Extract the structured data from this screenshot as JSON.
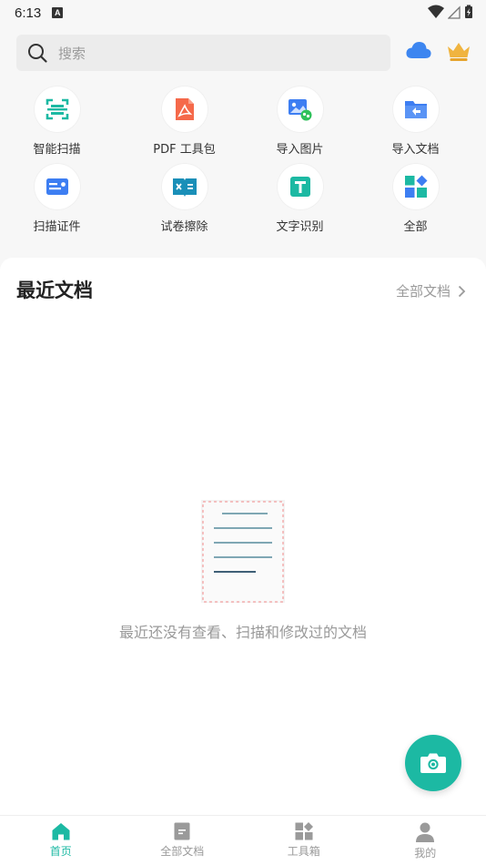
{
  "status": {
    "time": "6:13",
    "indicator": "A"
  },
  "search": {
    "placeholder": "搜索"
  },
  "header_icons": [
    "cloud-icon",
    "crown-icon"
  ],
  "tools": [
    {
      "label": "智能扫描",
      "icon": "scan-frame-icon",
      "color": "#1cb9a3"
    },
    {
      "label": "PDF 工具包",
      "icon": "pdf-icon",
      "color": "#f5694a"
    },
    {
      "label": "导入图片",
      "icon": "import-image-icon",
      "color": "#3d7ef2"
    },
    {
      "label": "导入文档",
      "icon": "import-document-icon",
      "color": "#3d7ef2"
    },
    {
      "label": "扫描证件",
      "icon": "id-card-icon",
      "color": "#3d7ef2"
    },
    {
      "label": "试卷擦除",
      "icon": "exam-erase-icon",
      "color": "#1a8fb8"
    },
    {
      "label": "文字识别",
      "icon": "text-recognition-icon",
      "color": "#1cb9a3"
    },
    {
      "label": "全部",
      "icon": "all-apps-icon",
      "color": "#1cb9a3"
    }
  ],
  "recent": {
    "title": "最近文档",
    "more_label": "全部文档",
    "empty_text": "最近还没有查看、扫描和修改过的文档"
  },
  "tabs": [
    {
      "label": "首页",
      "icon": "home-icon",
      "active": true
    },
    {
      "label": "全部文档",
      "icon": "document-icon",
      "active": false
    },
    {
      "label": "工具箱",
      "icon": "toolbox-icon",
      "active": false
    },
    {
      "label": "我的",
      "icon": "profile-icon",
      "active": false
    }
  ],
  "colors": {
    "accent": "#1cb9a3",
    "inactive": "#999999",
    "cloud": "#3d86f0",
    "crown": "#f0b440"
  }
}
